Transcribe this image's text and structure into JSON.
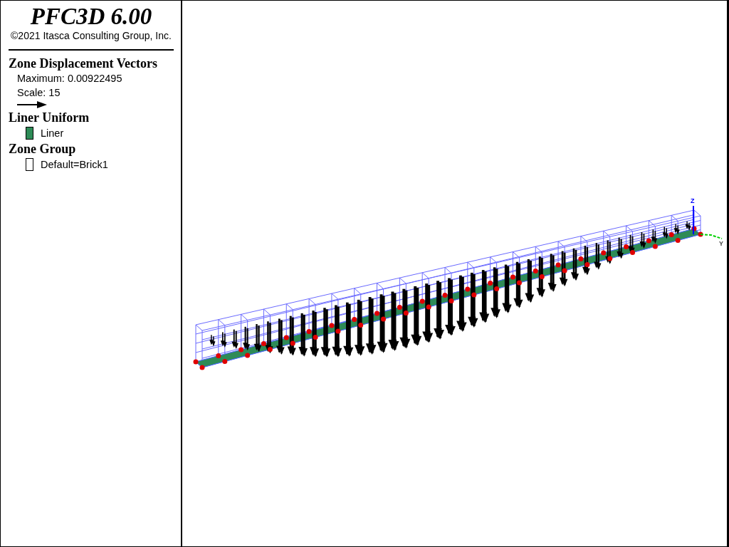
{
  "header": {
    "title": "PFC3D 6.00",
    "copyright": "©2021 Itasca Consulting Group, Inc."
  },
  "legend": [
    {
      "title": "Zone Displacement Vectors",
      "items": [
        {
          "kind": "text",
          "label": "Maximum: 0.00922495"
        },
        {
          "kind": "text",
          "label": "Scale: 15"
        },
        {
          "kind": "arrow"
        }
      ]
    },
    {
      "title": "Liner Uniform",
      "items": [
        {
          "kind": "swatch",
          "label": "Liner",
          "color": "#2e8b57"
        }
      ]
    },
    {
      "title": "Zone Group",
      "items": [
        {
          "kind": "swatch",
          "label": "Default=Brick1",
          "color": "#ffffff"
        }
      ]
    }
  ],
  "view": {
    "axes": [
      {
        "label": "Z"
      },
      {
        "label": "Y"
      }
    ]
  }
}
